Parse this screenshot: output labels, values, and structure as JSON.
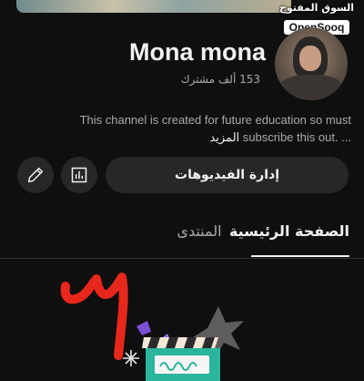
{
  "watermark": {
    "arabic": "السوق المفتوح",
    "latin": "OpenSooq"
  },
  "channel": {
    "name": "Mona mona",
    "subscribers": "153 ألف مشترك",
    "description_line1": "This channel is created for future education so must",
    "description_line2": "subscribe this out. ...",
    "more_label": "المزيد"
  },
  "actions": {
    "manage_videos_label": "إدارة الفيديوهات",
    "edit_icon": "pencil-icon",
    "stats_icon": "bar-chart-icon"
  },
  "tabs": {
    "home": "الصفحة الرئيسية",
    "community": "المنتدى"
  },
  "colors": {
    "background": "#0f0f0f",
    "button_bg": "#272727",
    "text_primary": "#f1f1f1",
    "text_secondary": "#aaaaaa",
    "scribble_red": "#e8271c",
    "clapper_teal": "#2bb59c"
  },
  "artwork": {
    "handwritten_numeral": "٣"
  }
}
